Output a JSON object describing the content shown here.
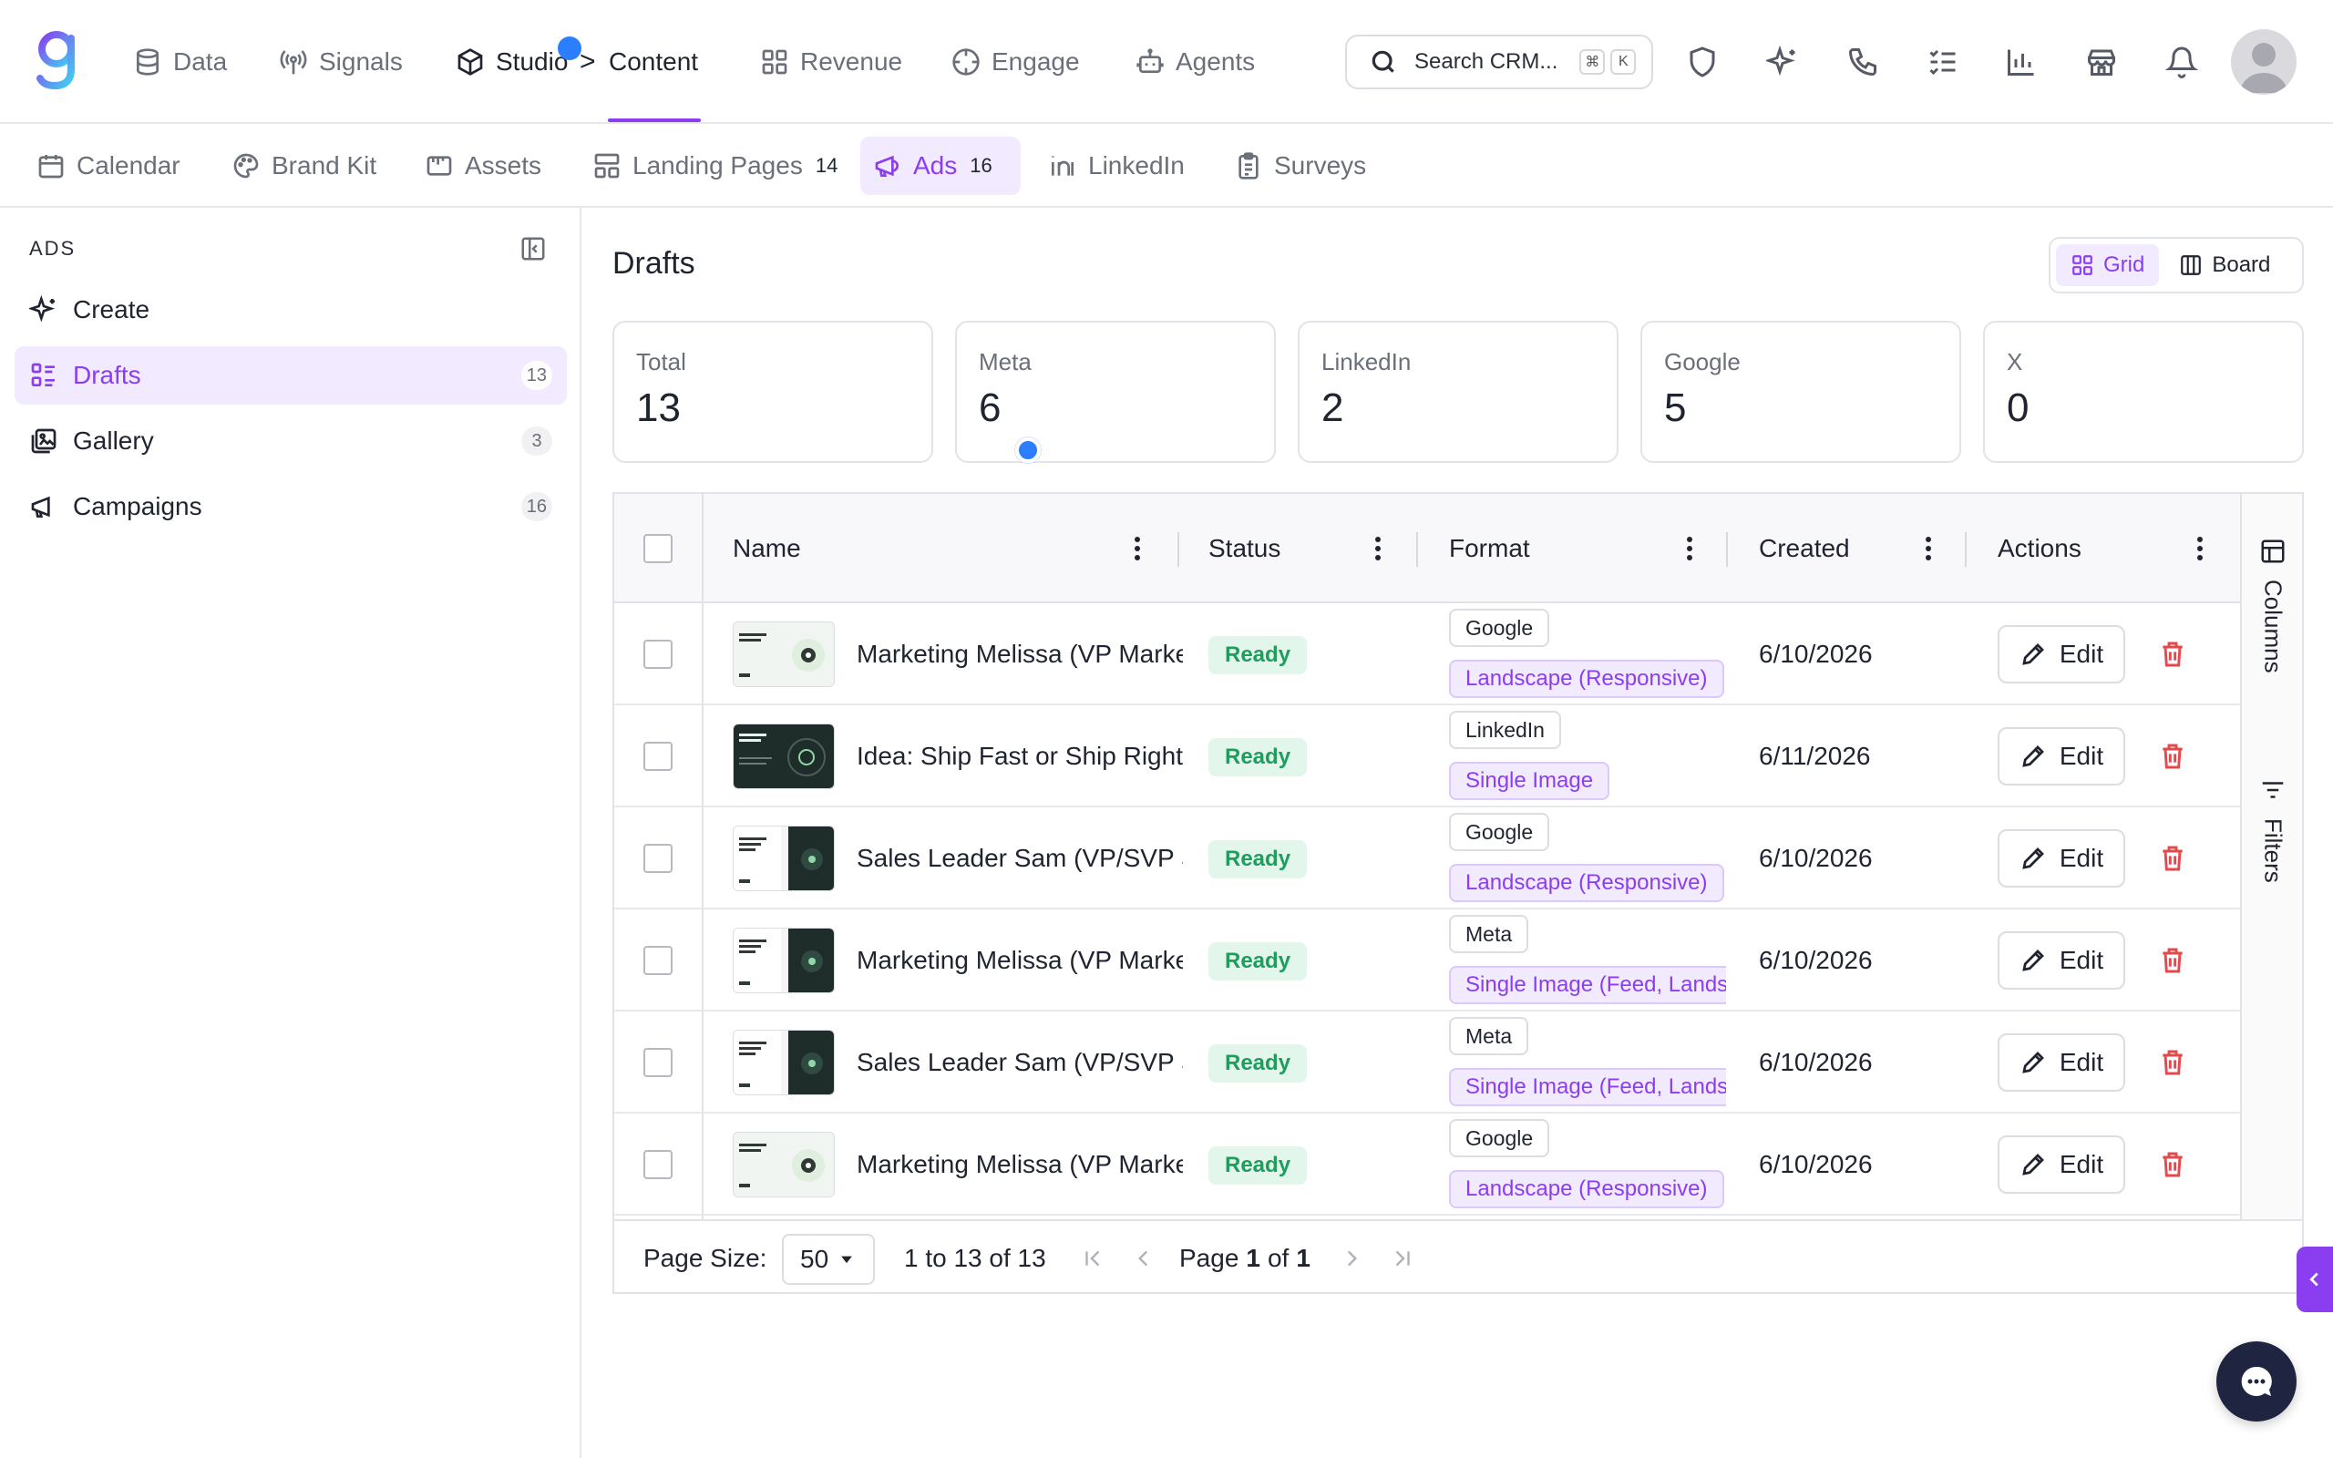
{
  "topnav": {
    "items": [
      {
        "label": "Data",
        "icon": "database-icon"
      },
      {
        "label": "Signals",
        "icon": "signal-icon"
      },
      {
        "label": "Studio",
        "icon": "cube-icon"
      },
      {
        "label": "Content",
        "icon": ""
      },
      {
        "label": "Revenue",
        "icon": "grid-icon"
      },
      {
        "label": "Engage",
        "icon": "target-icon"
      },
      {
        "label": "Agents",
        "icon": "bot-icon"
      }
    ],
    "breadcrumb_separator": ">",
    "search": {
      "placeholder": "Search CRM...",
      "shortcut_mod": "⌘",
      "shortcut_key": "K"
    },
    "tools": [
      "shield-icon",
      "sparkle-icon",
      "phone-icon",
      "checklist-icon",
      "bar-chart-icon",
      "store-icon",
      "bell-icon"
    ],
    "accent_color": "#8b3ef0"
  },
  "subnav": {
    "items": [
      {
        "label": "Calendar",
        "count": ""
      },
      {
        "label": "Brand Kit",
        "count": ""
      },
      {
        "label": "Assets",
        "count": ""
      },
      {
        "label": "Landing Pages",
        "count": "14"
      },
      {
        "label": "Ads",
        "count": "16"
      },
      {
        "label": "LinkedIn",
        "count": ""
      },
      {
        "label": "Surveys",
        "count": ""
      }
    ],
    "active": "Ads"
  },
  "sidebar": {
    "title": "ADS",
    "items": [
      {
        "label": "Create",
        "count": ""
      },
      {
        "label": "Drafts",
        "count": "13"
      },
      {
        "label": "Gallery",
        "count": "3"
      },
      {
        "label": "Campaigns",
        "count": "16"
      }
    ],
    "active": "Drafts"
  },
  "main": {
    "title": "Drafts",
    "view_toggle": {
      "grid": "Grid",
      "board": "Board",
      "active": "Grid"
    },
    "stats": [
      {
        "label": "Total",
        "value": "13"
      },
      {
        "label": "Meta",
        "value": "6"
      },
      {
        "label": "LinkedIn",
        "value": "2"
      },
      {
        "label": "Google",
        "value": "5"
      },
      {
        "label": "X",
        "value": "0"
      }
    ]
  },
  "table": {
    "columns": {
      "name": "Name",
      "status": "Status",
      "format": "Format",
      "created": "Created",
      "actions": "Actions"
    },
    "rows": [
      {
        "name": "Marketing Melissa (VP Marketing)",
        "status": "Ready",
        "platform": "Google",
        "format": "Landscape (Responsive)",
        "created": "6/10/2026",
        "thumb": "light"
      },
      {
        "name": "Idea: Ship Fast or Ship Right",
        "status": "Ready",
        "platform": "LinkedIn",
        "format": "Single Image",
        "created": "6/11/2026",
        "thumb": "dark"
      },
      {
        "name": "Sales Leader Sam (VP/SVP Sales)",
        "status": "Ready",
        "platform": "Google",
        "format": "Landscape (Responsive)",
        "created": "6/10/2026",
        "thumb": "split"
      },
      {
        "name": "Marketing Melissa (VP Marketing)",
        "status": "Ready",
        "platform": "Meta",
        "format": "Single Image (Feed, Landscape)",
        "created": "6/10/2026",
        "thumb": "split"
      },
      {
        "name": "Sales Leader Sam (VP/SVP Sales)",
        "status": "Ready",
        "platform": "Meta",
        "format": "Single Image (Feed, Landscape)",
        "created": "6/10/2026",
        "thumb": "split"
      },
      {
        "name": "Marketing Melissa (VP Marketing)",
        "status": "Ready",
        "platform": "Google",
        "format": "Landscape (Responsive)",
        "created": "6/10/2026",
        "thumb": "light"
      }
    ],
    "edit_label": "Edit",
    "side_tools": {
      "columns": "Columns",
      "filters": "Filters"
    },
    "pager": {
      "page_size_label": "Page Size:",
      "page_size": "50",
      "range": "1 to 13 of 13",
      "page_word": "Page",
      "page_current": "1",
      "page_of": "of",
      "page_total": "1"
    }
  }
}
